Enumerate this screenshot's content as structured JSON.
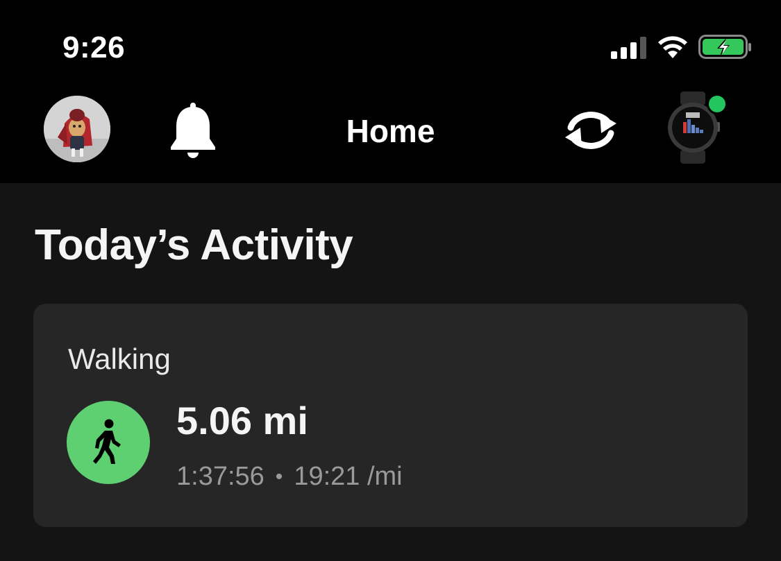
{
  "status_bar": {
    "time": "9:26",
    "signal_icon": "cellular-signal-icon",
    "wifi_icon": "wifi-icon",
    "battery_icon": "battery-charging-icon",
    "battery_color": "#34c759"
  },
  "nav": {
    "title": "Home",
    "avatar_icon": "dog-avatar",
    "bell_icon": "bell-icon",
    "sync_icon": "sync-icon",
    "device_icon": "smartwatch-icon",
    "device_status_color": "#22c55e"
  },
  "activity_section": {
    "title": "Today’s Activity",
    "card": {
      "type": "Walking",
      "icon": "walking-person-icon",
      "icon_color": "#5fd071",
      "distance": "5.06 mi",
      "duration": "1:37:56",
      "separator": "•",
      "pace": "19:21 /mi"
    }
  }
}
